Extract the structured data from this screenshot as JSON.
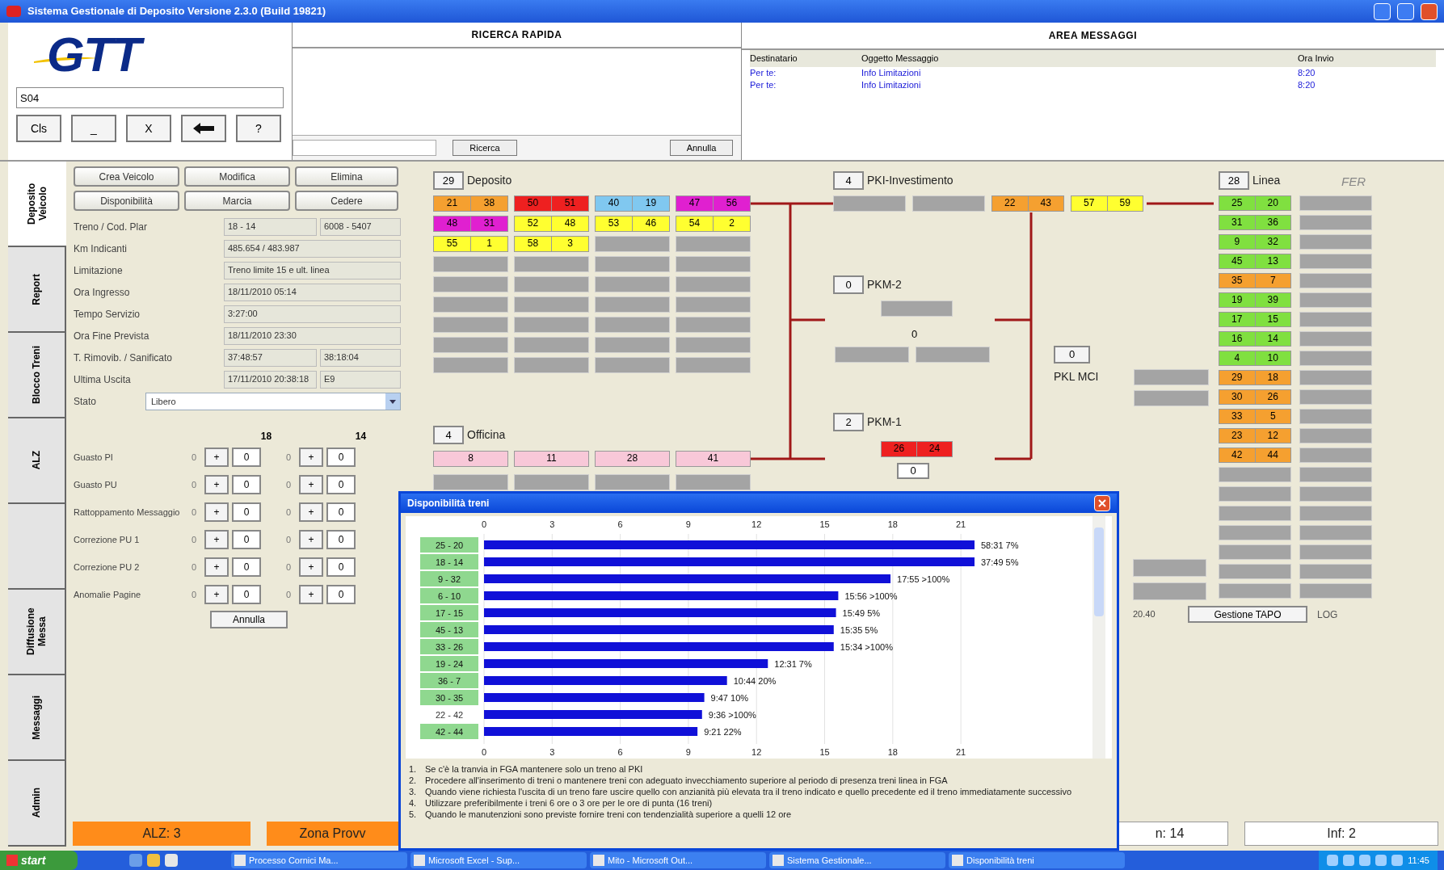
{
  "window": {
    "title": "Sistema Gestionale di Deposito Versione 2.3.0 (Build 19821)"
  },
  "top_left": {
    "logo": "GTT",
    "input_value": "S04",
    "buttons": [
      {
        "kind": "text",
        "label": "Cls"
      },
      {
        "kind": "text",
        "label": "_"
      },
      {
        "kind": "text",
        "label": "X"
      },
      {
        "kind": "arrow"
      },
      {
        "kind": "text",
        "label": "?"
      }
    ]
  },
  "quick_search": {
    "title": "RICERCA RAPIDA",
    "search_button": "Ricerca",
    "cancel_button": "Annulla"
  },
  "messages": {
    "title": "AREA MESSAGGI",
    "columns": [
      "Destinatario",
      "Oggetto Messaggio",
      "Ora Invio"
    ],
    "rows": [
      [
        "Per te:",
        "Info Limitazioni",
        "8:20"
      ],
      [
        "Per te:",
        "Info Limitazioni",
        "8:20"
      ]
    ]
  },
  "side_tabs": [
    {
      "label": "Deposito Veicolo",
      "selected": true
    },
    {
      "label": "Report",
      "selected": false
    },
    {
      "label": "Blocco Treni",
      "selected": false
    },
    {
      "label": "ALZ",
      "selected": false
    },
    {
      "selected": false
    },
    {
      "label": "Diffusione Messa",
      "selected": false
    },
    {
      "label": "Messaggi",
      "selected": false
    },
    {
      "label": "Admin",
      "selected": false
    }
  ],
  "form": {
    "buttons": [
      "Crea Veicolo",
      "Modifica",
      "Elimina",
      "Disponibilità",
      "Marcia",
      "Cedere"
    ],
    "fields": [
      {
        "label": "Treno / Cod. Plar",
        "values": [
          "18 - 14",
          "6008 - 5407"
        ]
      },
      {
        "label": "Km Indicanti",
        "values": [
          "485.654 / 483.987"
        ]
      },
      {
        "label": "Limitazione",
        "values": [
          "Treno limite 15 e ult. linea"
        ]
      },
      {
        "label": "Ora Ingresso",
        "values": [
          "18/11/2010 05:14"
        ]
      },
      {
        "label": "Tempo Servizio",
        "values": [
          "3:27:00"
        ]
      },
      {
        "label": "Ora Fine Prevista",
        "values": [
          "18/11/2010 23:30"
        ]
      },
      {
        "label": "T. Rimovib. / Sanificato",
        "values": [
          "37:48:57",
          "38:18:04"
        ]
      },
      {
        "label": "Ultima Uscita",
        "values": [
          "17/11/2010 20:38:18",
          "E9"
        ]
      }
    ],
    "state": {
      "label": "Stato",
      "value": "Libero"
    },
    "counter_columns": [
      "18",
      "14"
    ],
    "counters": [
      {
        "label": "Guasto PI",
        "cells": [
          {
            "count": "0",
            "value": "0"
          },
          {
            "count": "0",
            "value": "0"
          }
        ]
      },
      {
        "label": "Guasto PU",
        "cells": [
          {
            "count": "0",
            "value": "0"
          },
          {
            "count": "0",
            "value": "0"
          }
        ]
      },
      {
        "label": "Rattoppamento Messaggio",
        "cells": [
          {
            "count": "0",
            "value": "0"
          },
          {
            "count": "0",
            "value": "0"
          }
        ]
      },
      {
        "label": "Correzione PU 1",
        "cells": [
          {
            "count": "0",
            "value": "0"
          },
          {
            "count": "0",
            "value": "0"
          }
        ]
      },
      {
        "label": "Correzione PU 2",
        "cells": [
          {
            "count": "0",
            "value": "0"
          },
          {
            "count": "0",
            "value": "0"
          }
        ]
      },
      {
        "label": "Anomalie Pagine",
        "cells": [
          {
            "count": "0",
            "value": "0"
          },
          {
            "count": "0",
            "value": "0"
          }
        ]
      }
    ],
    "increment_label": "+",
    "cancel_button": "Annulla"
  },
  "diagram": {
    "deposito": {
      "count": "29",
      "label": "Deposito",
      "slots": [
        {
          "kind": "pair",
          "numbers": [
            "21",
            "38"
          ],
          "color": "#f5a030"
        },
        {
          "kind": "pair",
          "numbers": [
            "50",
            "51"
          ],
          "color": "#ee2020"
        },
        {
          "kind": "pair",
          "numbers": [
            "40",
            "19"
          ],
          "color": "#80c8f0"
        },
        {
          "kind": "pair",
          "numbers": [
            "47",
            "56"
          ],
          "color": "#e020d0"
        },
        {
          "kind": "pair",
          "numbers": [
            "48",
            "31"
          ],
          "color": "#e020d0"
        },
        {
          "kind": "pair",
          "numbers": [
            "52",
            "48"
          ],
          "color": "#ffff30"
        },
        {
          "kind": "pair",
          "numbers": [
            "53",
            "46"
          ],
          "color": "#ffff30"
        },
        {
          "kind": "pair",
          "numbers": [
            "54",
            "2"
          ],
          "color": "#ffff30"
        },
        {
          "kind": "pair",
          "numbers": [
            "55",
            "1"
          ],
          "color": "#ffff30"
        },
        {
          "kind": "pair",
          "numbers": [
            "58",
            "3"
          ],
          "color": "#ffff30"
        },
        {
          "kind": "empty"
        },
        {
          "kind": "empty"
        },
        {
          "kind": "empty"
        },
        {
          "kind": "empty"
        },
        {
          "kind": "empty"
        },
        {
          "kind": "empty"
        },
        {
          "kind": "empty"
        },
        {
          "kind": "empty"
        },
        {
          "kind": "empty"
        },
        {
          "kind": "empty"
        },
        {
          "kind": "empty"
        },
        {
          "kind": "empty"
        },
        {
          "kind": "empty"
        },
        {
          "kind": "empty"
        },
        {
          "kind": "empty"
        },
        {
          "kind": "empty"
        },
        {
          "kind": "empty"
        },
        {
          "kind": "empty"
        },
        {
          "kind": "empty"
        },
        {
          "kind": "empty"
        },
        {
          "kind": "empty"
        },
        {
          "kind": "empty"
        },
        {
          "kind": "empty"
        },
        {
          "kind": "empty"
        },
        {
          "kind": "empty"
        },
        {
          "kind": "empty"
        }
      ]
    },
    "officina": {
      "count": "4",
      "label": "Officina",
      "slots": [
        {
          "kind": "single",
          "numbers": [
            "8"
          ],
          "color": "#f8c8d8"
        },
        {
          "kind": "single",
          "numbers": [
            "11"
          ],
          "color": "#f8c8d8"
        },
        {
          "kind": "single",
          "numbers": [
            "28"
          ],
          "color": "#f8c8d8"
        },
        {
          "kind": "single",
          "numbers": [
            "41"
          ],
          "color": "#f8c8d8"
        },
        {
          "kind": "empty"
        },
        {
          "kind": "empty"
        },
        {
          "kind": "empty"
        },
        {
          "kind": "empty"
        }
      ]
    },
    "pki": {
      "count": "4",
      "label": "PKI-Investimento",
      "slots": [
        {
          "kind": "empty"
        },
        {
          "kind": "empty"
        },
        {
          "kind": "pair",
          "numbers": [
            "22",
            "43"
          ],
          "color": "#f5a030"
        },
        {
          "kind": "pair",
          "numbers": [
            "57",
            "59"
          ],
          "color": "#ffff30"
        }
      ]
    },
    "pkm2": {
      "count": "0",
      "label": "PKM-2",
      "top": [
        {
          "kind": "empty"
        }
      ],
      "middle": "0",
      "bottom": [
        {
          "kind": "empty"
        },
        {
          "kind": "empty"
        }
      ]
    },
    "pkm1": {
      "count": "2",
      "label": "PKM-1",
      "top": [
        {
          "kind": "pair",
          "numbers": [
            "26",
            "24"
          ],
          "color": "#ee2020"
        }
      ],
      "middle": "0"
    },
    "pkl": {
      "count": "0",
      "label": "PKL MCI",
      "slots": [
        {
          "kind": "empty"
        },
        {
          "kind": "empty"
        }
      ]
    },
    "extra_slots": [
      {
        "kind": "empty"
      },
      {
        "kind": "empty"
      }
    ],
    "linea": {
      "count": "28",
      "label": "Linea",
      "tag": "FER",
      "slots": [
        {
          "kind": "pair",
          "numbers": [
            "25",
            "20"
          ],
          "color": "#80e040"
        },
        {
          "kind": "empty"
        },
        {
          "kind": "pair",
          "numbers": [
            "31",
            "36"
          ],
          "color": "#80e040"
        },
        {
          "kind": "empty"
        },
        {
          "kind": "pair",
          "numbers": [
            "9",
            "32"
          ],
          "color": "#80e040"
        },
        {
          "kind": "empty"
        },
        {
          "kind": "pair",
          "numbers": [
            "45",
            "13"
          ],
          "color": "#80e040"
        },
        {
          "kind": "empty"
        },
        {
          "kind": "pair",
          "numbers": [
            "35",
            "7"
          ],
          "color": "#f5a030"
        },
        {
          "kind": "empty"
        },
        {
          "kind": "pair",
          "numbers": [
            "19",
            "39"
          ],
          "color": "#80e040"
        },
        {
          "kind": "empty"
        },
        {
          "kind": "pair",
          "numbers": [
            "17",
            "15"
          ],
          "color": "#80e040"
        },
        {
          "kind": "empty"
        },
        {
          "kind": "pair",
          "numbers": [
            "16",
            "14"
          ],
          "color": "#80e040"
        },
        {
          "kind": "empty"
        },
        {
          "kind": "pair",
          "numbers": [
            "4",
            "10"
          ],
          "color": "#80e040"
        },
        {
          "kind": "empty"
        },
        {
          "kind": "pair",
          "numbers": [
            "29",
            "18"
          ],
          "color": "#f5a030"
        },
        {
          "kind": "empty"
        },
        {
          "kind": "pair",
          "numbers": [
            "30",
            "26"
          ],
          "color": "#f5a030"
        },
        {
          "kind": "empty"
        },
        {
          "kind": "pair",
          "numbers": [
            "33",
            "5"
          ],
          "color": "#f5a030"
        },
        {
          "kind": "empty"
        },
        {
          "kind": "pair",
          "numbers": [
            "23",
            "12"
          ],
          "color": "#f5a030"
        },
        {
          "kind": "empty"
        },
        {
          "kind": "pair",
          "numbers": [
            "42",
            "44"
          ],
          "color": "#f5a030"
        },
        {
          "kind": "empty"
        },
        {
          "kind": "empty"
        },
        {
          "kind": "empty"
        },
        {
          "kind": "empty"
        },
        {
          "kind": "empty"
        },
        {
          "kind": "empty"
        },
        {
          "kind": "empty"
        },
        {
          "kind": "empty"
        },
        {
          "kind": "empty"
        },
        {
          "kind": "empty"
        },
        {
          "kind": "empty"
        },
        {
          "kind": "empty"
        },
        {
          "kind": "empty"
        },
        {
          "kind": "empty"
        },
        {
          "kind": "empty"
        }
      ]
    },
    "footer": {
      "time": "20.40",
      "button": "Gestione TAPO",
      "log": "LOG"
    }
  },
  "status_bar": [
    {
      "kind": "alert",
      "label": "ALZ: 3"
    },
    {
      "kind": "alert",
      "label": "Zona Provv"
    },
    {
      "kind": "info",
      "label": "n: 14"
    },
    {
      "kind": "info",
      "label": "Inf: 2"
    }
  ],
  "dialog": {
    "title": "Disponibilità treni",
    "top_axis_labels": [
      "0",
      "3",
      "6",
      "9",
      "12",
      "15",
      "18",
      "21"
    ],
    "category_highlight": [
      true,
      true,
      true,
      true,
      true,
      true,
      true,
      true,
      true,
      true,
      false,
      true
    ],
    "chart_data": {
      "type": "bar",
      "orientation": "horizontal",
      "categories": [
        "25 - 20",
        "18 - 14",
        "9 - 32",
        "6 - 10",
        "17 - 15",
        "45 - 13",
        "33 - 26",
        "19 - 24",
        "36 - 7",
        "30 - 35",
        "22 - 42",
        "42 - 44"
      ],
      "values": [
        21.6,
        21.6,
        17.9,
        15.6,
        15.5,
        15.4,
        15.4,
        12.5,
        10.7,
        9.7,
        9.6,
        9.4
      ],
      "xlim": [
        0,
        21.6
      ],
      "xticks": [
        0,
        3,
        6,
        9,
        12,
        15,
        18,
        21
      ],
      "grid": true
    },
    "bar_labels": [
      "58:31  7%",
      "37:49  5%",
      "17:55  >100%",
      "15:56  >100%",
      "15:49  5%",
      "15:35  5%",
      "15:34  >100%",
      "12:31  7%",
      "10:44  20%",
      "9:47  10%",
      "9:36  >100%",
      "9:21  22%"
    ],
    "notes": [
      {
        "number": "1.",
        "text": "Se c'è la tranvia in FGA mantenere solo un treno al PKI"
      },
      {
        "number": "2.",
        "text": "Procedere all'inserimento di treni o mantenere treni con adeguato invecchiamento superiore al periodo di presenza treni linea in FGA"
      },
      {
        "number": "3.",
        "text": "Quando viene richiesta l'uscita di un treno fare uscire quello con anzianità più elevata tra il treno indicato e quello precedente ed il treno immediatamente successivo"
      },
      {
        "number": "4.",
        "text": "Utilizzare preferibilmente i treni 6 ore o 3 ore per le ore di punta (16 treni)"
      },
      {
        "number": "5.",
        "text": "Quando le manutenzioni sono previste fornire treni con tendenzialità superiore a quelli 12 ore"
      }
    ]
  },
  "taskbar": {
    "start": "start",
    "tasks": [
      "Processo Cornici Ma...",
      "Microsoft Excel - Sup...",
      "Mito - Microsoft Out...",
      "Sistema Gestionale...",
      "Disponibilità treni"
    ],
    "clock": "11:45"
  }
}
